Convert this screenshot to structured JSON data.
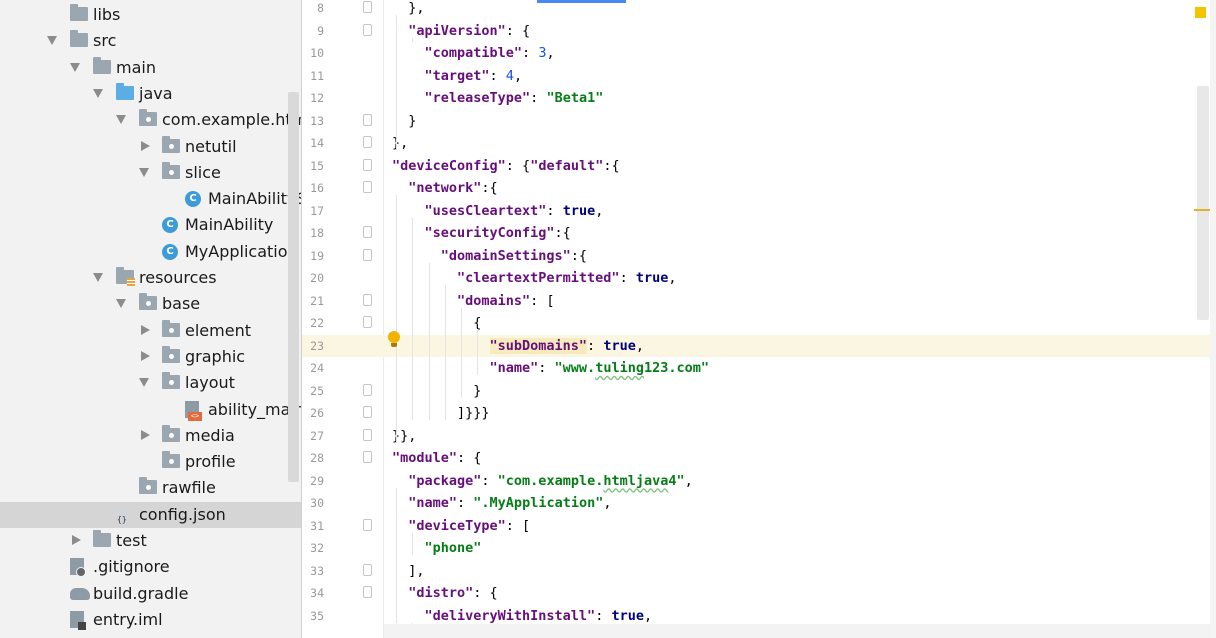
{
  "project_tree": {
    "rows": [
      {
        "label": "libs",
        "icon": "folder-icon",
        "depth": 2,
        "arrow": ""
      },
      {
        "label": "src",
        "icon": "folder-icon",
        "depth": 2,
        "arrow": "down"
      },
      {
        "label": "main",
        "icon": "folder-icon",
        "depth": 3,
        "arrow": "down"
      },
      {
        "label": "java",
        "icon": "folder-blue-icon",
        "depth": 4,
        "arrow": "down"
      },
      {
        "label": "com.example.htmlja",
        "icon": "package-icon",
        "depth": 5,
        "arrow": "down"
      },
      {
        "label": "netutil",
        "icon": "package-icon",
        "depth": 6,
        "arrow": "right"
      },
      {
        "label": "slice",
        "icon": "package-icon",
        "depth": 6,
        "arrow": "down"
      },
      {
        "label": "MainAbilitySl",
        "icon": "class-icon",
        "depth": 7,
        "arrow": ""
      },
      {
        "label": "MainAbility",
        "icon": "class-icon",
        "depth": 6,
        "arrow": ""
      },
      {
        "label": "MyApplication",
        "icon": "class-icon",
        "depth": 6,
        "arrow": ""
      },
      {
        "label": "resources",
        "icon": "resources-folder-icon",
        "depth": 4,
        "arrow": "down"
      },
      {
        "label": "base",
        "icon": "package-icon",
        "depth": 5,
        "arrow": "down"
      },
      {
        "label": "element",
        "icon": "package-icon",
        "depth": 6,
        "arrow": "right"
      },
      {
        "label": "graphic",
        "icon": "package-icon",
        "depth": 6,
        "arrow": "right"
      },
      {
        "label": "layout",
        "icon": "package-icon",
        "depth": 6,
        "arrow": "down"
      },
      {
        "label": "ability_main.x",
        "icon": "xml-file-icon",
        "depth": 7,
        "arrow": ""
      },
      {
        "label": "media",
        "icon": "package-icon",
        "depth": 6,
        "arrow": "right"
      },
      {
        "label": "profile",
        "icon": "package-icon",
        "depth": 6,
        "arrow": ""
      },
      {
        "label": "rawfile",
        "icon": "package-icon",
        "depth": 5,
        "arrow": ""
      },
      {
        "label": "config.json",
        "icon": "json-file-icon",
        "depth": 4,
        "arrow": "",
        "selected": true
      },
      {
        "label": "test",
        "icon": "folder-icon",
        "depth": 3,
        "arrow": "right"
      },
      {
        "label": ".gitignore",
        "icon": "gitignore-file-icon",
        "depth": 2,
        "arrow": ""
      },
      {
        "label": "build.gradle",
        "icon": "gradle-icon",
        "depth": 2,
        "arrow": ""
      },
      {
        "label": "entry.iml",
        "icon": "iml-file-icon",
        "depth": 2,
        "arrow": ""
      }
    ]
  },
  "editor": {
    "current_line": 23,
    "lines": [
      {
        "n": "8",
        "indent": 1,
        "fold": true,
        "tokens": [
          [
            "p",
            "},"
          ]
        ]
      },
      {
        "n": "9",
        "indent": 1,
        "fold": true,
        "tokens": [
          [
            "k",
            "\"apiVersion\""
          ],
          [
            "p",
            ": {"
          ]
        ]
      },
      {
        "n": "10",
        "indent": 2,
        "tokens": [
          [
            "k",
            "\"compatible\""
          ],
          [
            "p",
            ": "
          ],
          [
            "n",
            "3"
          ],
          [
            "p",
            ","
          ]
        ]
      },
      {
        "n": "11",
        "indent": 2,
        "tokens": [
          [
            "k",
            "\"target\""
          ],
          [
            "p",
            ": "
          ],
          [
            "n",
            "4"
          ],
          [
            "p",
            ","
          ]
        ]
      },
      {
        "n": "12",
        "indent": 2,
        "tokens": [
          [
            "k",
            "\"releaseType\""
          ],
          [
            "p",
            ": "
          ],
          [
            "s",
            "\"Beta1\""
          ]
        ]
      },
      {
        "n": "13",
        "indent": 1,
        "fold": true,
        "tokens": [
          [
            "p",
            "}"
          ]
        ]
      },
      {
        "n": "14",
        "indent": 0,
        "fold": true,
        "tokens": [
          [
            "p",
            "},"
          ]
        ]
      },
      {
        "n": "15",
        "indent": 0,
        "fold": true,
        "tokens": [
          [
            "k",
            "\"deviceConfig\""
          ],
          [
            "p",
            ": {"
          ],
          [
            "k",
            "\"default\""
          ],
          [
            "p",
            ":{"
          ]
        ]
      },
      {
        "n": "16",
        "indent": 1,
        "fold": true,
        "tokens": [
          [
            "k",
            "\"network\""
          ],
          [
            "p",
            ":{"
          ]
        ]
      },
      {
        "n": "17",
        "indent": 2,
        "tokens": [
          [
            "k",
            "\"usesCleartext\""
          ],
          [
            "p",
            ": "
          ],
          [
            "w",
            "true"
          ],
          [
            "p",
            ","
          ]
        ]
      },
      {
        "n": "18",
        "indent": 2,
        "fold": true,
        "tokens": [
          [
            "k",
            "\"securityConfig\""
          ],
          [
            "p",
            ":{"
          ]
        ]
      },
      {
        "n": "19",
        "indent": 3,
        "fold": true,
        "tokens": [
          [
            "k",
            "\"domainSettings\""
          ],
          [
            "p",
            ":{"
          ]
        ]
      },
      {
        "n": "20",
        "indent": 4,
        "tokens": [
          [
            "k",
            "\"cleartextPermitted\""
          ],
          [
            "p",
            ": "
          ],
          [
            "w",
            "true"
          ],
          [
            "p",
            ","
          ]
        ]
      },
      {
        "n": "21",
        "indent": 4,
        "fold": true,
        "tokens": [
          [
            "k",
            "\"domains\""
          ],
          [
            "p",
            ": ["
          ]
        ]
      },
      {
        "n": "22",
        "indent": 5,
        "fold": true,
        "tokens": [
          [
            "p",
            "{"
          ]
        ]
      },
      {
        "n": "23",
        "indent": 6,
        "tokens": [
          [
            "kh",
            "\"subDomains\""
          ],
          [
            "p",
            ": "
          ],
          [
            "w",
            "true"
          ],
          [
            "p",
            ","
          ]
        ]
      },
      {
        "n": "24",
        "indent": 6,
        "tokens": [
          [
            "k",
            "\"name\""
          ],
          [
            "p",
            ": "
          ],
          [
            "s",
            "\"www."
          ],
          [
            "st",
            "tuling"
          ],
          [
            "s",
            "123.com\""
          ]
        ]
      },
      {
        "n": "25",
        "indent": 5,
        "fold": true,
        "tokens": [
          [
            "p",
            "}"
          ]
        ]
      },
      {
        "n": "26",
        "indent": 4,
        "fold": true,
        "tokens": [
          [
            "p",
            "]}}}"
          ]
        ]
      },
      {
        "n": "27",
        "indent": 0,
        "fold": true,
        "tokens": [
          [
            "p",
            "}},"
          ]
        ]
      },
      {
        "n": "28",
        "indent": 0,
        "fold": true,
        "tokens": [
          [
            "k",
            "\"module\""
          ],
          [
            "p",
            ": {"
          ]
        ]
      },
      {
        "n": "29",
        "indent": 1,
        "tokens": [
          [
            "k",
            "\"package\""
          ],
          [
            "p",
            ": "
          ],
          [
            "s",
            "\"com.example."
          ],
          [
            "st",
            "htmljava"
          ],
          [
            "s",
            "4\""
          ],
          [
            "p",
            ","
          ]
        ]
      },
      {
        "n": "30",
        "indent": 1,
        "tokens": [
          [
            "k",
            "\"name\""
          ],
          [
            "p",
            ": "
          ],
          [
            "s",
            "\".MyApplication\""
          ],
          [
            "p",
            ","
          ]
        ]
      },
      {
        "n": "31",
        "indent": 1,
        "fold": true,
        "tokens": [
          [
            "k",
            "\"deviceType\""
          ],
          [
            "p",
            ": ["
          ]
        ]
      },
      {
        "n": "32",
        "indent": 2,
        "tokens": [
          [
            "s",
            "\"phone\""
          ]
        ]
      },
      {
        "n": "33",
        "indent": 1,
        "fold": true,
        "tokens": [
          [
            "p",
            "],"
          ]
        ]
      },
      {
        "n": "34",
        "indent": 1,
        "fold": true,
        "tokens": [
          [
            "k",
            "\"distro\""
          ],
          [
            "p",
            ": {"
          ]
        ]
      },
      {
        "n": "35",
        "indent": 2,
        "tokens": [
          [
            "k",
            "\"deliveryWithInstall\""
          ],
          [
            "p",
            ": "
          ],
          [
            "w",
            "true"
          ],
          [
            "p",
            ","
          ]
        ]
      }
    ]
  },
  "colors": {
    "tree_background": "#f2f2f2",
    "selection": "#d5d5d5",
    "json_key": "#660e7a",
    "json_string": "#067d17",
    "json_number": "#1750eb",
    "json_keyword": "#000080",
    "current_line": "#fbf6e2",
    "active_tab": "#4a88f7"
  }
}
